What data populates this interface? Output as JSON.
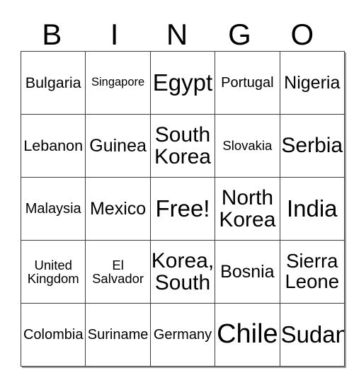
{
  "card": {
    "header_letters": [
      "B",
      "I",
      "N",
      "G",
      "O"
    ],
    "rows": [
      [
        {
          "text": "Bulgaria",
          "size": "m"
        },
        {
          "text": "Singapore",
          "size": "xs"
        },
        {
          "text": "Egypt",
          "size": "xxl"
        },
        {
          "text": "Portugal",
          "size": "sm"
        },
        {
          "text": "Nigeria",
          "size": "ml"
        }
      ],
      [
        {
          "text": "Lebanon",
          "size": "m"
        },
        {
          "text": "Guinea",
          "size": "ml"
        },
        {
          "text": "South\nKorea",
          "size": "xl"
        },
        {
          "text": "Slovakia",
          "size": "s"
        },
        {
          "text": "Serbia",
          "size": "xl"
        }
      ],
      [
        {
          "text": "Malaysia",
          "size": "sm"
        },
        {
          "text": "Mexico",
          "size": "ml"
        },
        {
          "text": "Free!",
          "size": "xxl"
        },
        {
          "text": "North\nKorea",
          "size": "xl"
        },
        {
          "text": "India",
          "size": "xxl"
        }
      ],
      [
        {
          "text": "United\nKingdom",
          "size": "s"
        },
        {
          "text": "El\nSalvador",
          "size": "s"
        },
        {
          "text": "Korea,\nSouth",
          "size": "xl"
        },
        {
          "text": "Bosnia",
          "size": "ml"
        },
        {
          "text": "Sierra\nLeone",
          "size": "l"
        }
      ],
      [
        {
          "text": "Colombia",
          "size": "sm"
        },
        {
          "text": "Suriname",
          "size": "sm"
        },
        {
          "text": "Germany",
          "size": "sm"
        },
        {
          "text": "Chile",
          "size": "huge"
        },
        {
          "text": "Sudan",
          "size": "xxl"
        }
      ]
    ]
  },
  "colors": {
    "background": "#ffffff",
    "text": "#000000",
    "grid_border": "#3d3d3d",
    "grid_outer_border": "#1a1a1a",
    "grid_shadow": "#9a9a9a"
  }
}
